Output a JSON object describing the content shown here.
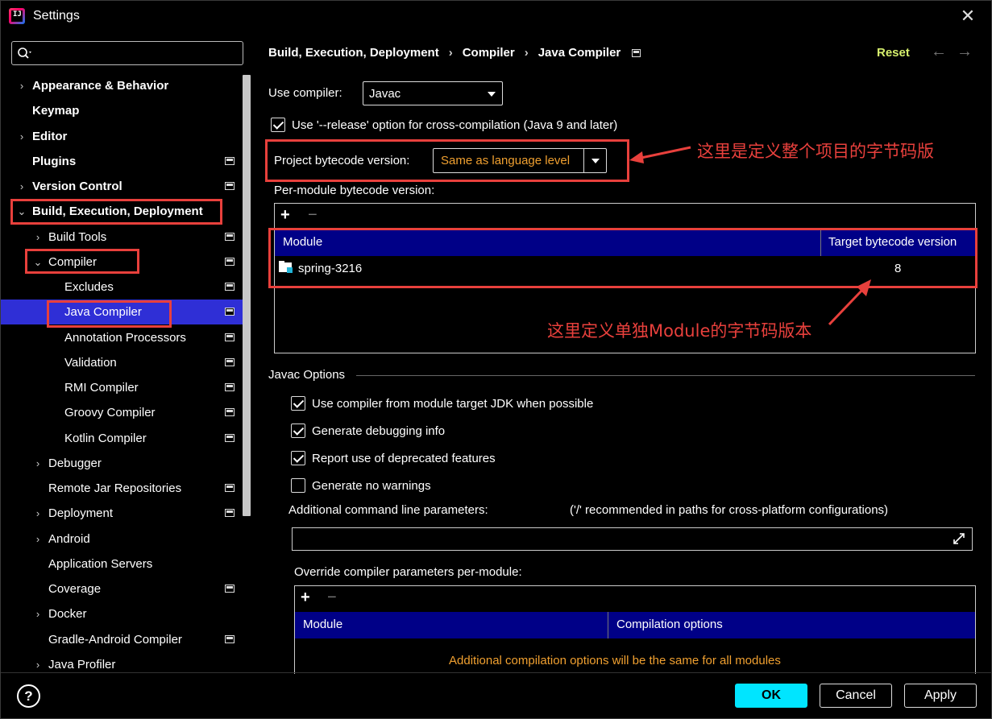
{
  "window": {
    "title": "Settings"
  },
  "search": {
    "placeholder": ""
  },
  "sidebar": {
    "items": [
      {
        "label": "Appearance & Behavior",
        "bold": true,
        "arrow": "›",
        "page_icon": false
      },
      {
        "label": "Keymap",
        "bold": true,
        "arrow": "",
        "page_icon": false
      },
      {
        "label": "Editor",
        "bold": true,
        "arrow": "›",
        "page_icon": false
      },
      {
        "label": "Plugins",
        "bold": true,
        "arrow": "",
        "page_icon": true
      },
      {
        "label": "Version Control",
        "bold": true,
        "arrow": "›",
        "page_icon": true
      },
      {
        "label": "Build, Execution, Deployment",
        "bold": true,
        "arrow": "⌄",
        "page_icon": false
      },
      {
        "label": "Build Tools",
        "bold": false,
        "arrow": "›",
        "page_icon": true
      },
      {
        "label": "Compiler",
        "bold": false,
        "arrow": "⌄",
        "page_icon": true
      },
      {
        "label": "Excludes",
        "bold": false,
        "arrow": "",
        "page_icon": true
      },
      {
        "label": "Java Compiler",
        "bold": false,
        "arrow": "",
        "page_icon": true,
        "selected": true
      },
      {
        "label": "Annotation Processors",
        "bold": false,
        "arrow": "",
        "page_icon": true
      },
      {
        "label": "Validation",
        "bold": false,
        "arrow": "",
        "page_icon": true
      },
      {
        "label": "RMI Compiler",
        "bold": false,
        "arrow": "",
        "page_icon": true
      },
      {
        "label": "Groovy Compiler",
        "bold": false,
        "arrow": "",
        "page_icon": true
      },
      {
        "label": "Kotlin Compiler",
        "bold": false,
        "arrow": "",
        "page_icon": true
      },
      {
        "label": "Debugger",
        "bold": false,
        "arrow": "›",
        "page_icon": false
      },
      {
        "label": "Remote Jar Repositories",
        "bold": false,
        "arrow": "",
        "page_icon": true
      },
      {
        "label": "Deployment",
        "bold": false,
        "arrow": "›",
        "page_icon": true
      },
      {
        "label": "Android",
        "bold": false,
        "arrow": "›",
        "page_icon": false
      },
      {
        "label": "Application Servers",
        "bold": false,
        "arrow": "",
        "page_icon": false
      },
      {
        "label": "Coverage",
        "bold": false,
        "arrow": "",
        "page_icon": true
      },
      {
        "label": "Docker",
        "bold": false,
        "arrow": "›",
        "page_icon": false
      },
      {
        "label": "Gradle-Android Compiler",
        "bold": false,
        "arrow": "",
        "page_icon": true
      },
      {
        "label": "Java Profiler",
        "bold": false,
        "arrow": "›",
        "page_icon": false
      }
    ]
  },
  "breadcrumb": {
    "part1": "Build, Execution, Deployment",
    "part2": "Compiler",
    "part3": "Java Compiler",
    "sep": "›"
  },
  "header": {
    "reset_label": "Reset",
    "back_arrow": "←",
    "forward_arrow": "→"
  },
  "compiler": {
    "use_compiler_label": "Use compiler:",
    "use_compiler_value": "Javac",
    "release_option_label": "Use '--release' option for cross-compilation (Java 9 and later)",
    "release_option_checked": true,
    "project_bytecode_label": "Project bytecode version:",
    "project_bytecode_value": "Same as language level",
    "per_module_label": "Per-module bytecode version:"
  },
  "module_table": {
    "add": "+",
    "remove": "−",
    "headers": [
      "Module",
      "Target bytecode version"
    ],
    "rows": [
      {
        "module": "spring-3216",
        "version": "8"
      }
    ]
  },
  "javac": {
    "section_label": "Javac Options",
    "options": [
      {
        "label": "Use compiler from module target JDK when possible",
        "checked": true
      },
      {
        "label": "Generate debugging info",
        "checked": true
      },
      {
        "label": "Report use of deprecated features",
        "checked": true
      },
      {
        "label": "Generate no warnings",
        "checked": false
      }
    ],
    "additional_params_label": "Additional command line parameters:",
    "additional_params_hint": "('/' recommended in paths for cross-platform configurations)",
    "additional_params_value": "",
    "override_label": "Override compiler parameters per-module:"
  },
  "override_table": {
    "add": "+",
    "remove": "−",
    "headers": [
      "Module",
      "Compilation options"
    ],
    "empty_text": "Additional compilation options will be the same for all modules"
  },
  "annotations": {
    "project_note": "这里是定义整个项目的字节码版",
    "module_note": "这里定义单独Module的字节码版本"
  },
  "footer": {
    "help": "?",
    "ok": "OK",
    "cancel": "Cancel",
    "apply": "Apply"
  },
  "colors": {
    "accent_selected": "#2f2fd6",
    "table_header": "#000087",
    "annotation_red": "#e8403c",
    "ok_button": "#00e5ff",
    "reset_link": "#d6f06d",
    "orange_value": "#f0a030"
  }
}
